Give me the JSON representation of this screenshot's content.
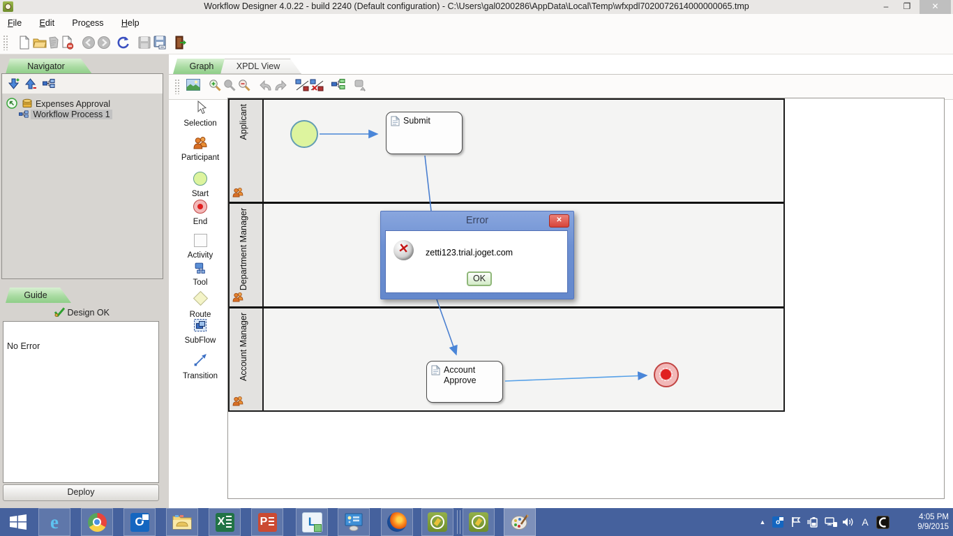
{
  "window": {
    "title": "Workflow Designer 4.0.22 - build 2240 (Default configuration) - C:\\Users\\gal0200286\\AppData\\Local\\Temp\\wfxpdl7020072614000000065.tmp"
  },
  "menu": {
    "items": [
      {
        "pre": "",
        "u": "F",
        "post": "ile"
      },
      {
        "pre": "",
        "u": "E",
        "post": "dit"
      },
      {
        "pre": "Pro",
        "u": "c",
        "post": "ess"
      },
      {
        "pre": "",
        "u": "H",
        "post": "elp"
      }
    ]
  },
  "main_toolbar": {
    "icons": [
      "new-document",
      "open-folder",
      "import-disabled",
      "close-document",
      "back-disabled",
      "forward-disabled",
      "refresh",
      "save-disabled",
      "save-as",
      "exit"
    ]
  },
  "navigator": {
    "tab_label": "Navigator",
    "toolbar_icons": [
      "add-package",
      "remove-package",
      "new-process"
    ],
    "tree": [
      {
        "label": "Expenses Approval",
        "selected": false
      },
      {
        "label": "Workflow Process 1",
        "selected": true
      }
    ]
  },
  "guide": {
    "tab_label": "Guide",
    "status": "Design OK",
    "message": "No Error",
    "deploy_label": "Deploy"
  },
  "graph": {
    "tabs": [
      {
        "label": "Graph",
        "active": true
      },
      {
        "label": "XPDL View",
        "active": false
      }
    ],
    "toolbar_icons": [
      "export-image",
      "zoom-in",
      "zoom-actual",
      "zoom-out",
      "undo",
      "redo",
      "clean-transitions",
      "remove-transitions",
      "organize",
      "layout-disabled"
    ],
    "palette": [
      {
        "label": "Selection"
      },
      {
        "label": "Participant"
      },
      {
        "label": "Start"
      },
      {
        "label": "End"
      },
      {
        "label": "Activity"
      },
      {
        "label": "Tool"
      },
      {
        "label": "Route"
      },
      {
        "label": "SubFlow"
      },
      {
        "label": "Transition"
      }
    ],
    "lanes": [
      {
        "label": "Applicant"
      },
      {
        "label": "Department Manager"
      },
      {
        "label": "Account Manager"
      }
    ],
    "nodes": {
      "submit": "Submit",
      "account_approve": "Account Approve"
    }
  },
  "error_dialog": {
    "title": "Error",
    "message": "zetti123.trial.joget.com",
    "ok_label": "OK"
  },
  "taskbar": {
    "apps": [
      "internet-explorer",
      "chrome",
      "outlook",
      "file-explorer",
      "excel",
      "powerpoint",
      "lync",
      "remote-desktop",
      "firefox",
      "workflow-designer-1",
      "workflow-designer-2",
      "paint"
    ],
    "tray": {
      "language": "A",
      "time": "4:05 PM",
      "date": "9/9/2015"
    }
  },
  "colors": {
    "taskbar_blue": "#45619d",
    "tab_green": "#a9dba2",
    "dialog_blue": "#7092d3",
    "error_red": "#d6443a",
    "arrow_blue": "#4a86d8",
    "start_fill": "#ddf49e",
    "end_fill": "#f2b8b8"
  }
}
